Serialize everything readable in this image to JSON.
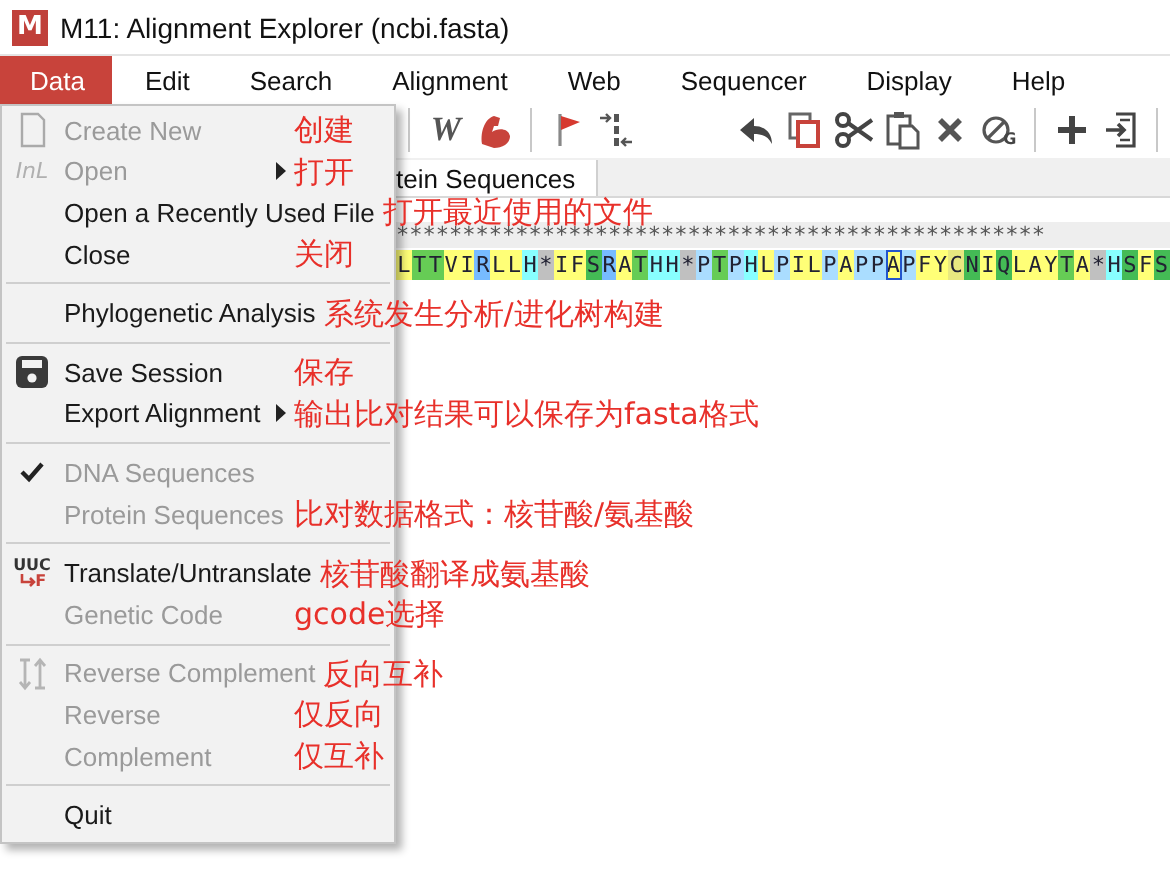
{
  "window": {
    "title": "M11: Alignment Explorer (ncbi.fasta)",
    "app_icon_label": "M"
  },
  "menu_bar": [
    {
      "label": "Data",
      "selected": true
    },
    {
      "label": "Edit",
      "selected": false
    },
    {
      "label": "Search",
      "selected": false
    },
    {
      "label": "Alignment",
      "selected": false
    },
    {
      "label": "Web",
      "selected": false
    },
    {
      "label": "Sequencer",
      "selected": false
    },
    {
      "label": "Display",
      "selected": false
    },
    {
      "label": "Help",
      "selected": false
    }
  ],
  "toolbar": [
    {
      "kind": "separator"
    },
    {
      "kind": "web",
      "label": "W"
    },
    {
      "kind": "muscle"
    },
    {
      "kind": "separator"
    },
    {
      "kind": "flag"
    },
    {
      "kind": "gap"
    },
    {
      "kind": "spacer"
    },
    {
      "kind": "undo"
    },
    {
      "kind": "copy"
    },
    {
      "kind": "cut"
    },
    {
      "kind": "paste"
    },
    {
      "kind": "delete"
    },
    {
      "kind": "gcode",
      "label": "G"
    },
    {
      "kind": "separator"
    },
    {
      "kind": "add"
    },
    {
      "kind": "import"
    },
    {
      "kind": "separator"
    }
  ],
  "tab": {
    "label": "tein Sequences",
    "selected": true
  },
  "consensus_row": "*************************************************",
  "sequence": [
    {
      "r": "L",
      "color": "#ffff77",
      "selected": false
    },
    {
      "r": "T",
      "color": "#66cc55",
      "selected": false
    },
    {
      "r": "T",
      "color": "#66cc55",
      "selected": false
    },
    {
      "r": "V",
      "color": "#ffff77",
      "selected": false
    },
    {
      "r": "I",
      "color": "#ffff77",
      "selected": false
    },
    {
      "r": "R",
      "color": "#77bbff",
      "selected": false
    },
    {
      "r": "L",
      "color": "#ffff77",
      "selected": false
    },
    {
      "r": "L",
      "color": "#ffff77",
      "selected": false
    },
    {
      "r": "H",
      "color": "#88ffff",
      "selected": false
    },
    {
      "r": "*",
      "color": "#c0c0c0",
      "selected": false
    },
    {
      "r": "I",
      "color": "#ffff77",
      "selected": false
    },
    {
      "r": "F",
      "color": "#ffff77",
      "selected": false
    },
    {
      "r": "S",
      "color": "#44bb55",
      "selected": false
    },
    {
      "r": "R",
      "color": "#77bbff",
      "selected": false
    },
    {
      "r": "A",
      "color": "#ffff77",
      "selected": false
    },
    {
      "r": "T",
      "color": "#66cc55",
      "selected": false
    },
    {
      "r": "H",
      "color": "#88ffff",
      "selected": false
    },
    {
      "r": "H",
      "color": "#88ffff",
      "selected": false
    },
    {
      "r": "*",
      "color": "#c0c0c0",
      "selected": false
    },
    {
      "r": "P",
      "color": "#aaddff",
      "selected": false
    },
    {
      "r": "T",
      "color": "#66cc55",
      "selected": false
    },
    {
      "r": "P",
      "color": "#aaddff",
      "selected": false
    },
    {
      "r": "H",
      "color": "#88ffff",
      "selected": false
    },
    {
      "r": "L",
      "color": "#ffff77",
      "selected": false
    },
    {
      "r": "P",
      "color": "#aaddff",
      "selected": false
    },
    {
      "r": "I",
      "color": "#ffff77",
      "selected": false
    },
    {
      "r": "L",
      "color": "#ffff77",
      "selected": false
    },
    {
      "r": "P",
      "color": "#aaddff",
      "selected": false
    },
    {
      "r": "A",
      "color": "#ffff77",
      "selected": false
    },
    {
      "r": "P",
      "color": "#aaddff",
      "selected": false
    },
    {
      "r": "P",
      "color": "#aaddff",
      "selected": false
    },
    {
      "r": "A",
      "color": "#ffff77",
      "selected": true
    },
    {
      "r": "P",
      "color": "#aaddff",
      "selected": false
    },
    {
      "r": "F",
      "color": "#ffff77",
      "selected": false
    },
    {
      "r": "Y",
      "color": "#ffff77",
      "selected": false
    },
    {
      "r": "C",
      "color": "#e8e880",
      "selected": false
    },
    {
      "r": "N",
      "color": "#44bb55",
      "selected": false
    },
    {
      "r": "I",
      "color": "#ffff77",
      "selected": false
    },
    {
      "r": "Q",
      "color": "#44bb55",
      "selected": false
    },
    {
      "r": "L",
      "color": "#ffff77",
      "selected": false
    },
    {
      "r": "A",
      "color": "#ffff77",
      "selected": false
    },
    {
      "r": "Y",
      "color": "#ffff77",
      "selected": false
    },
    {
      "r": "T",
      "color": "#66cc55",
      "selected": false
    },
    {
      "r": "A",
      "color": "#ffff77",
      "selected": false
    },
    {
      "r": "*",
      "color": "#c0c0c0",
      "selected": false
    },
    {
      "r": "H",
      "color": "#88ffff",
      "selected": false
    },
    {
      "r": "S",
      "color": "#44bb55",
      "selected": false
    },
    {
      "r": "F",
      "color": "#ffff77",
      "selected": false
    },
    {
      "r": "S",
      "color": "#44bb55",
      "selected": false
    }
  ],
  "data_menu": {
    "groups": [
      [
        {
          "label": "Create New",
          "disabled": true,
          "checked": false,
          "submenu": false,
          "note": "创建"
        },
        {
          "label": "Open",
          "icon_text": "InL",
          "disabled": true,
          "checked": false,
          "submenu": true,
          "note": "打开"
        },
        {
          "label": "Open a Recently Used File",
          "disabled": false,
          "checked": false,
          "submenu": false,
          "note": "打开最近使用的文件"
        },
        {
          "label": "Close",
          "disabled": false,
          "checked": false,
          "submenu": false,
          "note": "关闭"
        }
      ],
      [
        {
          "label": "Phylogenetic Analysis",
          "disabled": false,
          "checked": false,
          "submenu": false,
          "note": "系统发生分析/进化树构建"
        }
      ],
      [
        {
          "label": "Save Session",
          "disabled": false,
          "checked": false,
          "submenu": false,
          "note": "保存"
        },
        {
          "label": "Export Alignment",
          "disabled": false,
          "checked": false,
          "submenu": true,
          "note": "输出比对结果可以保存为fasta格式"
        }
      ],
      [
        {
          "label": "DNA Sequences",
          "disabled": true,
          "checked": true,
          "submenu": false
        },
        {
          "label": "Protein Sequences",
          "disabled": true,
          "checked": false,
          "submenu": false,
          "note": "比对数据格式：核苷酸/氨基酸"
        }
      ],
      [
        {
          "label": "Translate/Untranslate",
          "icon_text": "UUC",
          "icon_sub": "F",
          "disabled": false,
          "checked": false,
          "submenu": false,
          "note": "核苷酸翻译成氨基酸"
        },
        {
          "label": "Genetic Code",
          "disabled": true,
          "checked": false,
          "submenu": false,
          "note": "gcode选择"
        }
      ],
      [
        {
          "label": "Reverse Complement",
          "disabled": true,
          "checked": false,
          "submenu": false,
          "note": "反向互补"
        },
        {
          "label": "Reverse",
          "disabled": true,
          "checked": false,
          "submenu": false,
          "note": "仅反向"
        },
        {
          "label": "Complement",
          "disabled": true,
          "checked": false,
          "submenu": false,
          "note": "仅互补"
        }
      ],
      [
        {
          "label": "Quit",
          "disabled": false,
          "checked": false,
          "submenu": false
        }
      ]
    ]
  }
}
